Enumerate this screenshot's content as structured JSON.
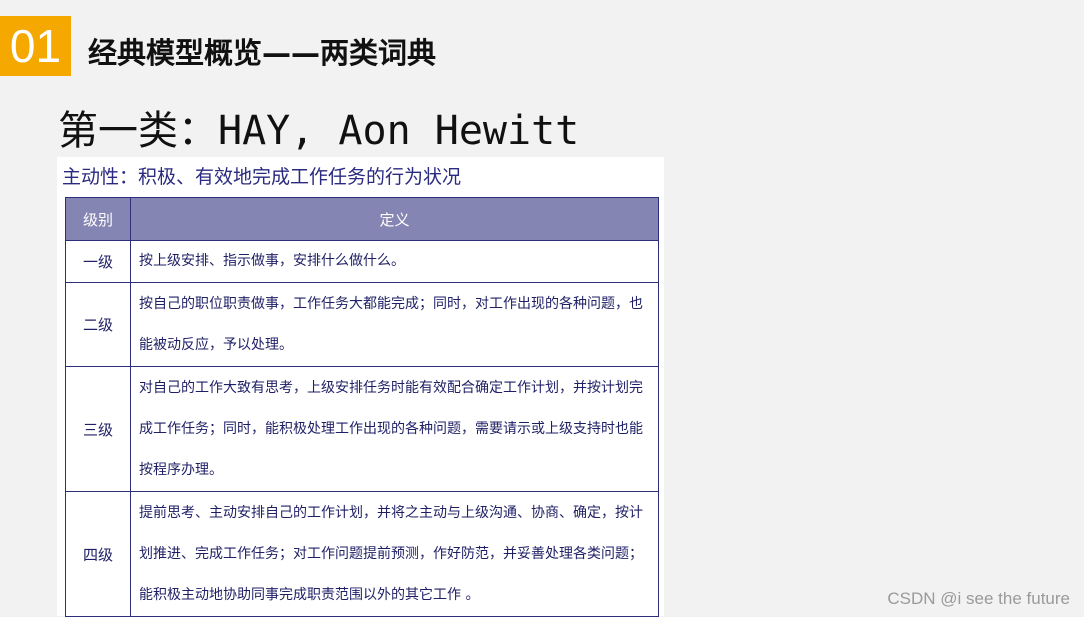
{
  "header": {
    "section_number": "01",
    "title": "经典模型概览——两类词典"
  },
  "subtitle": "第一类：HAY, Aon Hewitt",
  "definition": "主动性：积极、有效地完成工作任务的行为状况",
  "table": {
    "columns": [
      "级别",
      "定义"
    ],
    "rows": [
      {
        "level": "一级",
        "text": "按上级安排、指示做事，安排什么做什么。"
      },
      {
        "level": "二级",
        "text": "按自己的职位职责做事，工作任务大都能完成；同时，对工作出现的各种问题，也能被动反应，予以处理。"
      },
      {
        "level": "三级",
        "text": "对自己的工作大致有思考，上级安排任务时能有效配合确定工作计划，并按计划完成工作任务；同时，能积极处理工作出现的各种问题，需要请示或上级支持时也能按程序办理。"
      },
      {
        "level": "四级",
        "text": "提前思考、主动安排自己的工作计划，并将之主动与上级沟通、协商、确定，按计划推进、完成工作任务；对工作问题提前预测，作好防范，并妥善处理各类问题；能积极主动地协助同事完成职责范围以外的其它工作 。"
      }
    ]
  },
  "watermark": "CSDN @i see the future",
  "colors": {
    "badge": "#f5a800",
    "table_header": "#8585b3",
    "table_border": "#2e2e7a",
    "text_blue": "#2a2a80"
  }
}
